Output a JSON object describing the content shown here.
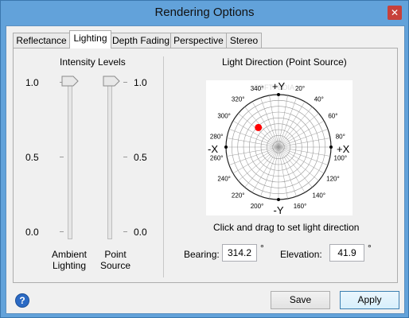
{
  "window": {
    "title": "Rendering Options",
    "close_glyph": "✕"
  },
  "tabs": [
    {
      "label": "Reflectance"
    },
    {
      "label": "Lighting",
      "active": true
    },
    {
      "label": "Depth Fading"
    },
    {
      "label": "Perspective"
    },
    {
      "label": "Stereo"
    }
  ],
  "intensity": {
    "title": "Intensity Levels",
    "levels": [
      "1.0",
      "0.5",
      "0.0"
    ],
    "ambient": {
      "label_line1": "Ambient",
      "label_line2": "Lighting",
      "value": 1.0
    },
    "point": {
      "label_line1": "Point",
      "label_line2": "Source",
      "value": 1.0
    }
  },
  "light_direction": {
    "title": "Light Direction (Point Source)",
    "instruction": "Click and drag to set light direction",
    "axes": {
      "top": "+Y",
      "bottom": "-Y",
      "left": "-X",
      "right": "+X"
    },
    "angle_labels": [
      "340°",
      "320°",
      "300°",
      "280°",
      "260°",
      "240°",
      "220°",
      "200°",
      "160°",
      "140°",
      "120°",
      "100°",
      "80°",
      "60°",
      "40°",
      "20°"
    ],
    "watermark": "SOFTPEDIA",
    "bearing_label": "Bearing:",
    "bearing_value": "314.2",
    "elevation_label": "Elevation:",
    "elevation_value": "41.9",
    "degree_symbol": "°",
    "marker_color": "#ff0000"
  },
  "buttons": {
    "save": "Save",
    "apply": "Apply"
  },
  "help": {
    "glyph": "?"
  }
}
